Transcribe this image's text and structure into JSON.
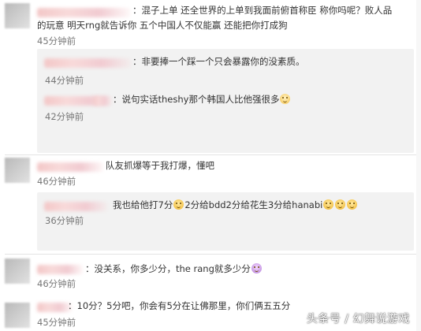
{
  "comments": [
    {
      "line1": "：混子上单 还全世界的上单到我面前俯首称臣 称你吗呢？败人品",
      "line2": "的玩意 明天rng就告诉你 五个中国人不仅能赢 还能把你打成狗",
      "time": "45分钟前"
    },
    {
      "text": "：非要捧一个踩一个只会暴露你的没素质。",
      "time": "44分钟前"
    },
    {
      "text": "：说句实话theshy那个韩国人比他强很多",
      "time": "42分钟前"
    },
    {
      "text": "队友抓爆等于我打爆，懂吧",
      "time": "46分钟前"
    },
    {
      "text_a": "我也给他打7分",
      "text_b": "2分给bdd2分给花生3分给hanabi",
      "time": "36分钟前"
    },
    {
      "text": "：没关系，你多少分，the rang就多少分",
      "time": "46分钟前"
    },
    {
      "text": "：10分？5分吧，你会有5分在让佛那里，你们俩五五分",
      "time": "45分钟前"
    }
  ],
  "watermark": "头条号 / 幻舞说游戏"
}
